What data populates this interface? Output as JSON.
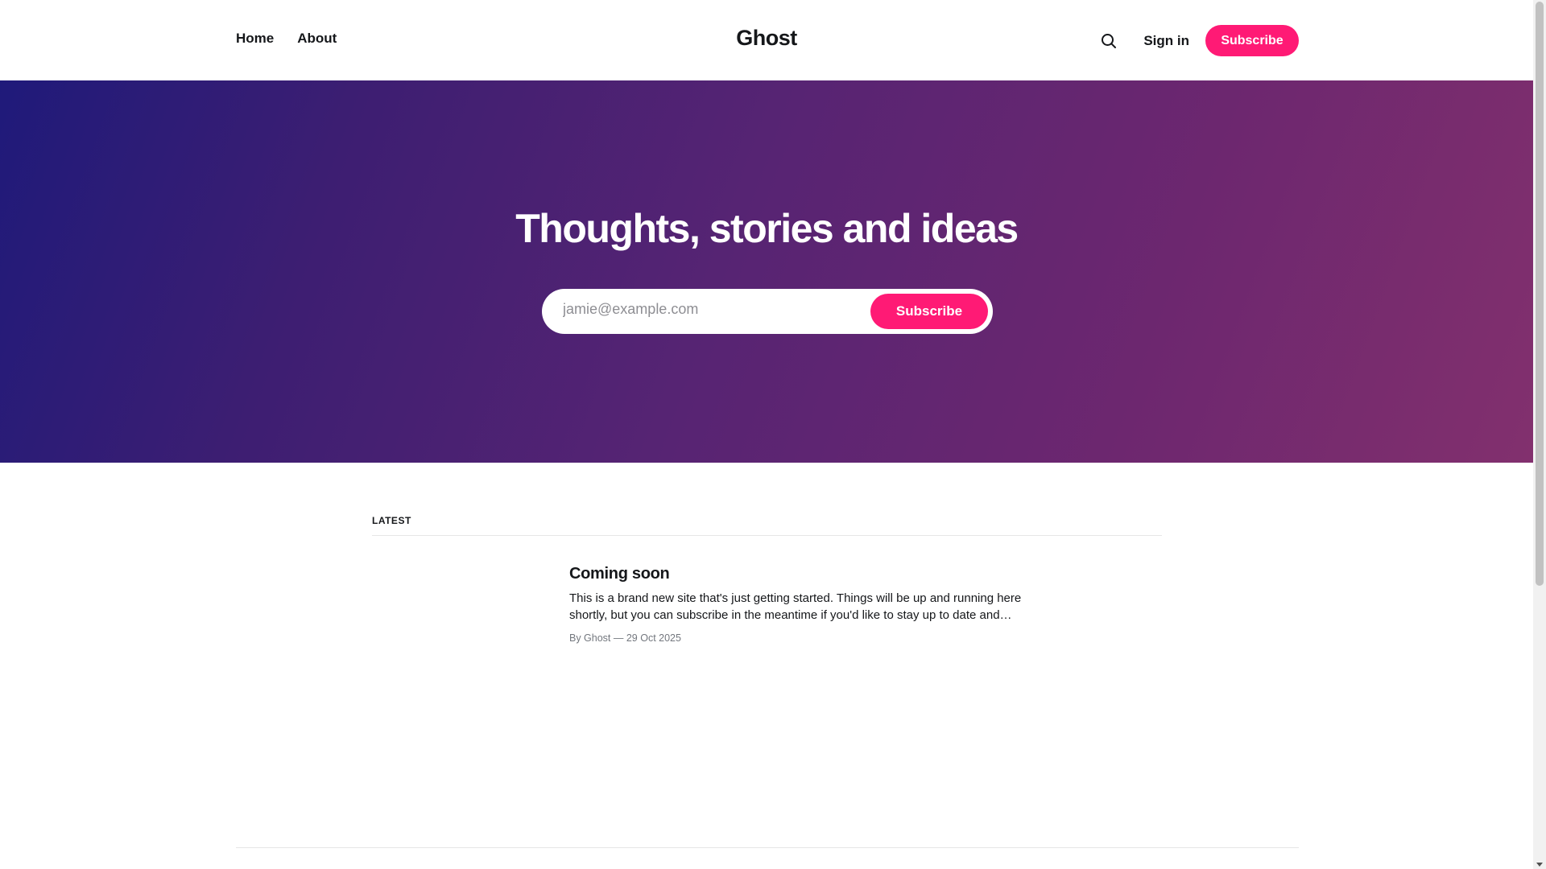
{
  "header": {
    "nav": [
      {
        "label": "Home"
      },
      {
        "label": "About"
      }
    ],
    "brand": "Ghost",
    "search_icon": "search-icon",
    "signin_label": "Sign in",
    "subscribe_label": "Subscribe"
  },
  "hero": {
    "title": "Thoughts, stories and ideas",
    "email_placeholder": "jamie@example.com",
    "subscribe_label": "Subscribe",
    "gradient_colors": [
      "#1f1a7a",
      "#82306e"
    ]
  },
  "main": {
    "section_label": "LATEST",
    "posts": [
      {
        "title": "Coming soon",
        "excerpt": "This is a brand new site that's just getting started. Things will be up and running here shortly, but you can subscribe in the meantime if you'd like to stay up to date and…",
        "meta": "By Ghost — 29 Oct 2025"
      }
    ]
  },
  "colors": {
    "accent": "#ff1a75",
    "text": "#15171a",
    "muted": "#73777e"
  }
}
